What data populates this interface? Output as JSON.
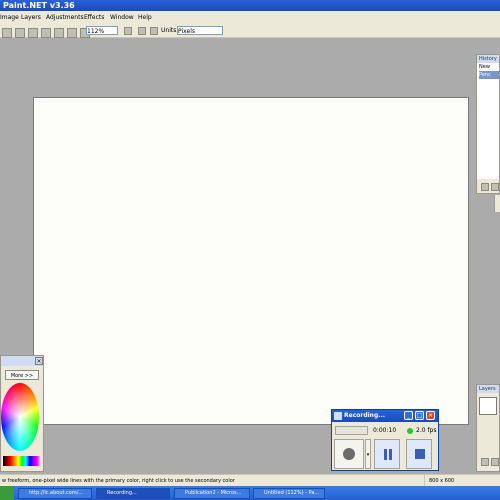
{
  "app": {
    "title": "Paint.NET v3.36"
  },
  "menu": {
    "items": [
      "Image",
      "Layers",
      "Adjustments",
      "Effects",
      "Window",
      "Help"
    ]
  },
  "toolbar": {
    "zoom": "112%",
    "units_label": "Units:",
    "units_value": "Pixels"
  },
  "colors_panel": {
    "more_label": "More >>"
  },
  "history_panel": {
    "title": "History",
    "items": [
      "New",
      "Penc"
    ]
  },
  "layers_panel": {
    "title": "Layers"
  },
  "recording": {
    "title": "Recording...",
    "elapsed": "0:00:10",
    "fps": "2.0 fps",
    "status_color": "#22cc22"
  },
  "status": {
    "hint": "w freeform, one-pixel wide lines with the primary color, right click to use the secondary color",
    "image_size": "800 x 600"
  },
  "taskbar": {
    "items": [
      "http://lc.about.com/...",
      "Recording...",
      "Publication2 - Micros...",
      "Untitled (112%) - Pa..."
    ]
  },
  "colors": {
    "accent": "#1a4ab8",
    "canvas_bg": "#fdfdf9",
    "workspace_bg": "#ababab"
  }
}
